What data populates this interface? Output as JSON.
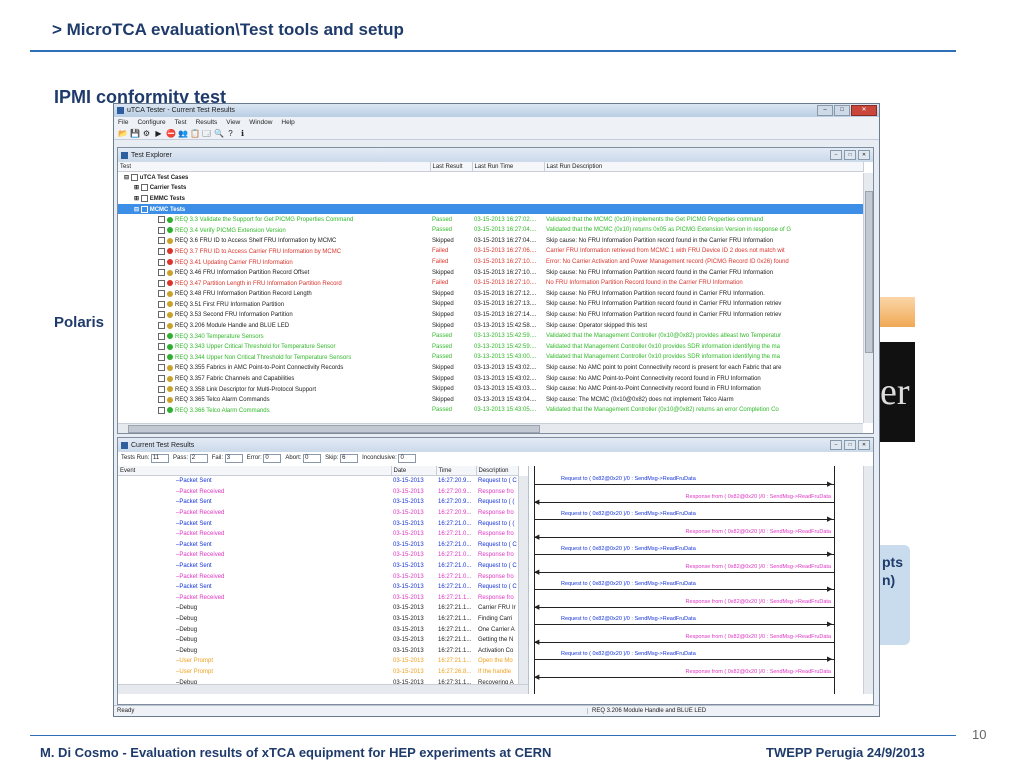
{
  "slide": {
    "header": "> MicroTCA evaluation\\Test tools and setup",
    "subtitle": "IPMI conformity test",
    "polaris": "Polaris",
    "bg_black_text": "er",
    "bg_blue_text_1": "pts",
    "bg_blue_text_2": "n)",
    "footer_left": "M. Di Cosmo - Evaluation results of xTCA  equipment for HEP experiments  at CERN",
    "footer_right": "TWEPP Perugia 24/9/2013",
    "page_number": "10"
  },
  "window": {
    "title": "uTCA Tester - Current Test Results",
    "menu": [
      "File",
      "Configure",
      "Test",
      "Results",
      "View",
      "Window",
      "Help"
    ],
    "status_left": "Ready",
    "status_right": "REQ 3.206 Module Handle and BLUE LED"
  },
  "explorer": {
    "title": "Test Explorer",
    "columns": [
      "Test",
      "Last Result",
      "Last Run Time",
      "Last Run Description"
    ],
    "root": "uTCA Test Cases",
    "groups": [
      "Carrier Tests",
      "EMMC Tests",
      "MCMC Tests"
    ],
    "rows": [
      {
        "name": "REQ 3.3 Validate the Support for Get PICMG Properties Command",
        "result": "Passed",
        "time": "03-15-2013 16:27:02....",
        "desc": "Validated that the MCMC (0x10) implements the Get PICMG Properties command",
        "color": "green"
      },
      {
        "name": "REQ 3.4 Verify PICMG Extension Version",
        "result": "Passed",
        "time": "03-15-2013 16:27:04....",
        "desc": "Validated that the MCMC (0x10) returns 0x05 as PICMG Extension Version in response of G",
        "color": "green"
      },
      {
        "name": "REQ 3.6 FRU ID to Access Shelf FRU Information by MCMC",
        "result": "Skipped",
        "time": "03-15-2013 16:27:04....",
        "desc": "Skip cause: No FRU Information Partition record found in the Carrier FRU Information",
        "color": "dark"
      },
      {
        "name": "REQ 3.7 FRU ID to Access Carrier FRU Information by MCMC",
        "result": "Failed",
        "time": "03-15-2013 16:27:06....",
        "desc": "Carrier FRU Information retrieved from MCMC 1 with FRU Device ID 2 does not match wit",
        "color": "red"
      },
      {
        "name": "REQ 3.41 Updating Carrier FRU Information",
        "result": "Failed",
        "time": "03-15-2013 16:27:10....",
        "desc": "Error: No Carrier Activation and Power Management record (PICMG Record ID 0x26) found",
        "color": "red"
      },
      {
        "name": "REQ 3.46 FRU Information Partition Record Offset",
        "result": "Skipped",
        "time": "03-15-2013 16:27:10....",
        "desc": "Skip cause: No FRU Information Partition record found in the Carrier FRU Information",
        "color": "dark"
      },
      {
        "name": "REQ 3.47 Partition Length in FRU Information Partition Record",
        "result": "Failed",
        "time": "03-15-2013 16:27:10....",
        "desc": "No FRU Information Partition Record found in the Carrier FRU Information",
        "color": "red"
      },
      {
        "name": "REQ 3.48 FRU Information Partition Record Length",
        "result": "Skipped",
        "time": "03-15-2013 16:27:12....",
        "desc": "Skip cause: No FRU Information Partition record found in Carrier FRU Information.",
        "color": "dark"
      },
      {
        "name": "REQ 3.51 First FRU Information Partition",
        "result": "Skipped",
        "time": "03-15-2013 16:27:13....",
        "desc": "Skip cause: No FRU Information Partition record found in Carrier FRU Information retriev",
        "color": "dark"
      },
      {
        "name": "REQ 3.53 Second FRU Information Partition",
        "result": "Skipped",
        "time": "03-15-2013 16:27:14....",
        "desc": "Skip cause: No FRU Information Partition record found in Carrier FRU Information retriev",
        "color": "dark"
      },
      {
        "name": "REQ 3.206 Module Handle and BLUE LED",
        "result": "Skipped",
        "time": "03-13-2013 15:42:58....",
        "desc": "Skip cause: Operator skipped this test",
        "color": "dark"
      },
      {
        "name": "REQ 3.340 Temperature Sensors",
        "result": "Passed",
        "time": "03-13-2013 15:42:59....",
        "desc": "Validated that the Management Controller (0x10@0x82) provides atleast two Temperatur",
        "color": "green"
      },
      {
        "name": "REQ 3.343 Upper Critical Threshold for Temperature Sensor",
        "result": "Passed",
        "time": "03-13-2013 15:42:59....",
        "desc": "Validated that Management Controller 0x10 provides SDR information identifying the ma",
        "color": "green"
      },
      {
        "name": "REQ 3.344 Upper Non Critical Threshold for Temperature Sensors",
        "result": "Passed",
        "time": "03-13-2013 15:43:00....",
        "desc": "Validated that Management Controller 0x10 provides SDR information identifying the ma",
        "color": "green"
      },
      {
        "name": "REQ 3.355 Fabrics in AMC Point-to-Point Connectivity Records",
        "result": "Skipped",
        "time": "03-13-2013 15:43:02....",
        "desc": "Skip cause: No AMC point to point Connectivity record is present for each Fabric that are",
        "color": "dark"
      },
      {
        "name": "REQ 3.357 Fabric Channels and Capabilities",
        "result": "Skipped",
        "time": "03-13-2013 15:43:02....",
        "desc": "Skip cause: No AMC Point-to-Point Connectivity record found in FRU Information",
        "color": "dark"
      },
      {
        "name": "REQ 3.358 Link Descriptor for Multi-Protocol Support",
        "result": "Skipped",
        "time": "03-13-2013 15:43:03....",
        "desc": "Skip cause: No AMC Point-to-Point Connectivity record found in FRU Information",
        "color": "dark"
      },
      {
        "name": "REQ 3.365 Telco Alarm Commands",
        "result": "Skipped",
        "time": "03-13-2013 15:43:04....",
        "desc": "Skip cause: The MCMC (0x10@0x82) does not implement Telco Alarm",
        "color": "dark"
      },
      {
        "name": "REQ 3.366 Telco Alarm Commands",
        "result": "Passed",
        "time": "03-13-2013 15:43:05....",
        "desc": "Validated that the Management Controller (0x10@0x82) returns an error Completion Co",
        "color": "green"
      }
    ]
  },
  "results": {
    "title": "Current Test Results",
    "stats": [
      {
        "label": "Tests Run:",
        "value": "11"
      },
      {
        "label": "Pass:",
        "value": "2"
      },
      {
        "label": "Fail:",
        "value": "3"
      },
      {
        "label": "Error:",
        "value": "0"
      },
      {
        "label": "Abort:",
        "value": "0"
      },
      {
        "label": "Skip:",
        "value": "6"
      },
      {
        "label": "Inconclusive:",
        "value": "0"
      }
    ],
    "columns": [
      "Event",
      "Date",
      "Time",
      "Description"
    ],
    "events": [
      {
        "event": "Packet Sent",
        "date": "03-15-2013",
        "time": "16:27:20.9...",
        "desc": "Request to ( C",
        "color": "blue"
      },
      {
        "event": "Packet Received",
        "date": "03-15-2013",
        "time": "16:27:20.9...",
        "desc": "Response fro",
        "color": "pink"
      },
      {
        "event": "Packet Sent",
        "date": "03-15-2013",
        "time": "16:27:20.9...",
        "desc": "Request to ( (",
        "color": "blue"
      },
      {
        "event": "Packet Received",
        "date": "03-15-2013",
        "time": "16:27:20.9...",
        "desc": "Response fro",
        "color": "pink"
      },
      {
        "event": "Packet Sent",
        "date": "03-15-2013",
        "time": "16:27:21.0...",
        "desc": "Request to ( (",
        "color": "blue"
      },
      {
        "event": "Packet Received",
        "date": "03-15-2013",
        "time": "16:27:21.0...",
        "desc": "Response fro",
        "color": "pink"
      },
      {
        "event": "Packet Sent",
        "date": "03-15-2013",
        "time": "16:27:21.0...",
        "desc": "Request to ( C",
        "color": "blue"
      },
      {
        "event": "Packet Received",
        "date": "03-15-2013",
        "time": "16:27:21.0...",
        "desc": "Response fro",
        "color": "pink"
      },
      {
        "event": "Packet Sent",
        "date": "03-15-2013",
        "time": "16:27:21.0...",
        "desc": "Request to ( C",
        "color": "blue"
      },
      {
        "event": "Packet Received",
        "date": "03-15-2013",
        "time": "16:27:21.0...",
        "desc": "Response fro",
        "color": "pink"
      },
      {
        "event": "Packet Sent",
        "date": "03-15-2013",
        "time": "16:27:21.0...",
        "desc": "Request to ( C",
        "color": "blue"
      },
      {
        "event": "Packet Received",
        "date": "03-15-2013",
        "time": "16:27:21.1...",
        "desc": "Response fro",
        "color": "pink"
      },
      {
        "event": "Debug",
        "date": "03-15-2013",
        "time": "16:27:21.1...",
        "desc": "Carrier FRU Ir",
        "color": "dark"
      },
      {
        "event": "Debug",
        "date": "03-15-2013",
        "time": "16:27:21.1...",
        "desc": "Finding Carri",
        "color": "dark"
      },
      {
        "event": "Debug",
        "date": "03-15-2013",
        "time": "16:27:21.1...",
        "desc": "One Carrier A",
        "color": "dark"
      },
      {
        "event": "Debug",
        "date": "03-15-2013",
        "time": "16:27:21.1...",
        "desc": "Getting the N",
        "color": "dark"
      },
      {
        "event": "Debug",
        "date": "03-15-2013",
        "time": "16:27:21.1...",
        "desc": "Activation Co",
        "color": "dark"
      },
      {
        "event": "User Prompt",
        "date": "03-15-2013",
        "time": "16:27:21.1...",
        "desc": "Open the Mo",
        "color": "orange"
      },
      {
        "event": "User Prompt",
        "date": "03-15-2013",
        "time": "16:27:26.8...",
        "desc": "If the handle",
        "color": "orange"
      },
      {
        "event": "Debug",
        "date": "03-15-2013",
        "time": "16:27:31.1...",
        "desc": "Recovering A",
        "color": "dark"
      }
    ],
    "sequence": [
      {
        "text": "Request to ( 0x82@0x20 )/0 : SendMsg->ReadFruData",
        "dir": "right"
      },
      {
        "text": "Response from ( 0x82@0x20 )/0 : SendMsg->ReadFruData",
        "dir": "left"
      },
      {
        "text": "Request to ( 0x82@0x20 )/0 : SendMsg->ReadFruData",
        "dir": "right"
      },
      {
        "text": "Response from ( 0x82@0x20 )/0 : SendMsg->ReadFruData",
        "dir": "left"
      },
      {
        "text": "Request to ( 0x82@0x20 )/0 : SendMsg->ReadFruData",
        "dir": "right"
      },
      {
        "text": "Response from ( 0x82@0x20 )/0 : SendMsg->ReadFruData",
        "dir": "left"
      },
      {
        "text": "Request to ( 0x82@0x20 )/0 : SendMsg->ReadFruData",
        "dir": "right"
      },
      {
        "text": "Response from ( 0x82@0x20 )/0 : SendMsg->ReadFruData",
        "dir": "left"
      },
      {
        "text": "Request to ( 0x82@0x20 )/0 : SendMsg->ReadFruData",
        "dir": "right"
      },
      {
        "text": "Response from ( 0x82@0x20 )/0 : SendMsg->ReadFruData",
        "dir": "left"
      },
      {
        "text": "Request to ( 0x82@0x20 )/0 : SendMsg->ReadFruData",
        "dir": "right"
      },
      {
        "text": "Response from ( 0x82@0x20 )/0 : SendMsg->ReadFruData",
        "dir": "left"
      }
    ]
  },
  "colors": {
    "slide_accent": "#1f3b6b",
    "rule": "#2e6fb7",
    "passed": "#31b82a",
    "failed": "#d9352c",
    "sent": "#1433d6",
    "received": "#de35c4",
    "prompt": "#f0a01e",
    "selection": "#3d8ee6"
  }
}
